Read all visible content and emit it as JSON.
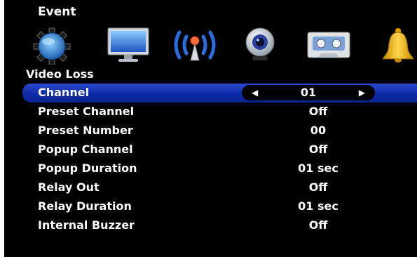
{
  "header": {
    "title": "Event"
  },
  "icons": [
    "gear-icon",
    "monitor-icon",
    "wireless-icon",
    "webcam-icon",
    "tape-icon",
    "bell-icon"
  ],
  "section": {
    "title": "Video Loss"
  },
  "rows": [
    {
      "label": "Channel",
      "value": "01"
    },
    {
      "label": "Preset Channel",
      "value": "Off"
    },
    {
      "label": "Preset Number",
      "value": "00"
    },
    {
      "label": "Popup Channel",
      "value": "Off"
    },
    {
      "label": "Popup Duration",
      "value": "01 sec"
    },
    {
      "label": "Relay Out",
      "value": "Off"
    },
    {
      "label": "Relay Duration",
      "value": "01 sec"
    },
    {
      "label": "Internal Buzzer",
      "value": "Off"
    }
  ],
  "colors": {
    "selection": "#0d2aa8",
    "background": "#000000",
    "text": "#ffffff"
  }
}
